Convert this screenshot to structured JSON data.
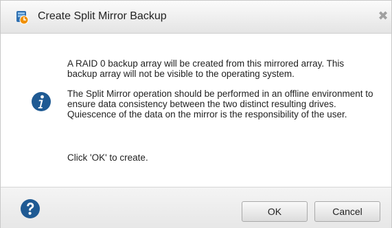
{
  "dialog": {
    "title": "Create Split Mirror Backup",
    "close_glyph": "✖",
    "title_icon": "backup-array-icon"
  },
  "message": {
    "icon": "info-icon",
    "paragraph1": "A RAID 0 backup array will be created from this mirrored array. This backup array will not be visible to the operating system.",
    "paragraph2": "The Split Mirror operation should be performed in an offline environment to ensure data consistency between the two distinct resulting drives. Quiescence of the data on the mirror is the responsibility of the user.",
    "paragraph3": "Click 'OK' to create."
  },
  "footer": {
    "help_icon": "help-icon",
    "ok_label": "OK",
    "cancel_label": "Cancel"
  },
  "colors": {
    "info_blue": "#1f5a93",
    "help_blue": "#1f5a93",
    "orange_accent": "#f09000"
  }
}
